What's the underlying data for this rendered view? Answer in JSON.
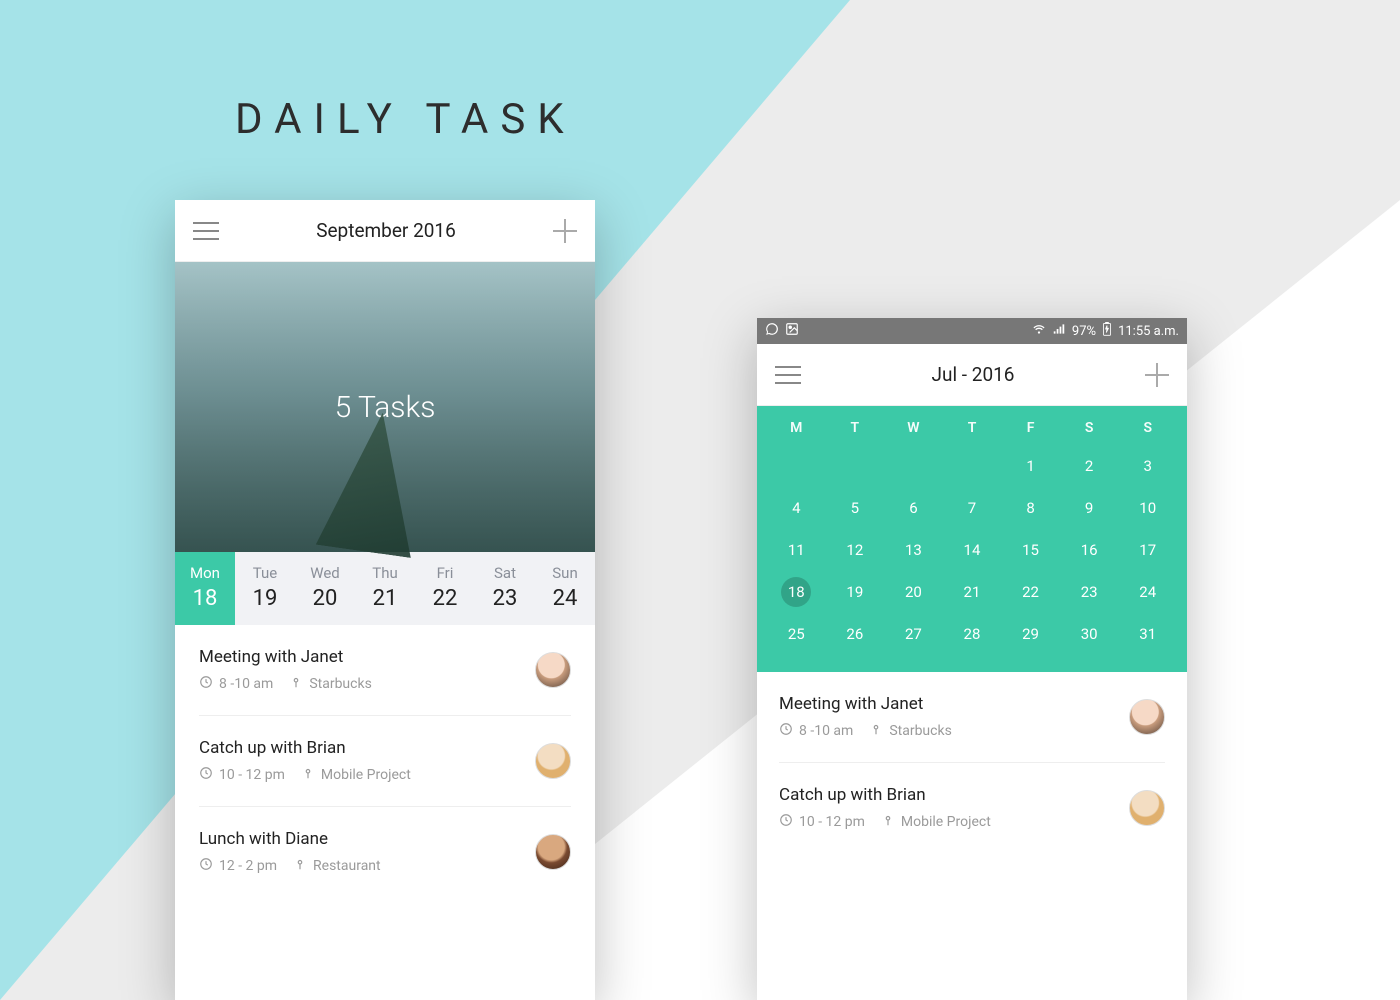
{
  "page_title": "DAILY TASK",
  "screen1": {
    "appbar_title": "September 2016",
    "hero_text": "5 Tasks",
    "week": [
      {
        "label": "Mon",
        "num": "18",
        "active": true
      },
      {
        "label": "Tue",
        "num": "19",
        "active": false
      },
      {
        "label": "Wed",
        "num": "20",
        "active": false
      },
      {
        "label": "Thu",
        "num": "21",
        "active": false
      },
      {
        "label": "Fri",
        "num": "22",
        "active": false
      },
      {
        "label": "Sat",
        "num": "23",
        "active": false
      },
      {
        "label": "Sun",
        "num": "24",
        "active": false
      }
    ],
    "tasks": [
      {
        "title": "Meeting with Janet",
        "time": "8 -10 am",
        "place": "Starbucks"
      },
      {
        "title": "Catch up with Brian",
        "time": "10 - 12 pm",
        "place": "Mobile Project"
      },
      {
        "title": "Lunch with Diane",
        "time": "12 - 2 pm",
        "place": "Restaurant"
      }
    ]
  },
  "screen2": {
    "status": {
      "battery": "97%",
      "time": "11:55 a.m."
    },
    "appbar_title": "Jul - 2016",
    "dow": [
      "M",
      "T",
      "W",
      "T",
      "F",
      "S",
      "S"
    ],
    "grid": [
      [
        "",
        "",
        "",
        "",
        "1",
        "2",
        "3"
      ],
      [
        "4",
        "5",
        "6",
        "7",
        "8",
        "9",
        "10"
      ],
      [
        "11",
        "12",
        "13",
        "14",
        "15",
        "16",
        "17"
      ],
      [
        "18",
        "19",
        "20",
        "21",
        "22",
        "23",
        "24"
      ],
      [
        "25",
        "26",
        "27",
        "28",
        "29",
        "30",
        "31"
      ]
    ],
    "selected": "18",
    "tasks": [
      {
        "title": "Meeting with Janet",
        "time": "8 -10 am",
        "place": "Starbucks"
      },
      {
        "title": "Catch up with Brian",
        "time": "10 - 12 pm",
        "place": "Mobile Project"
      }
    ]
  }
}
